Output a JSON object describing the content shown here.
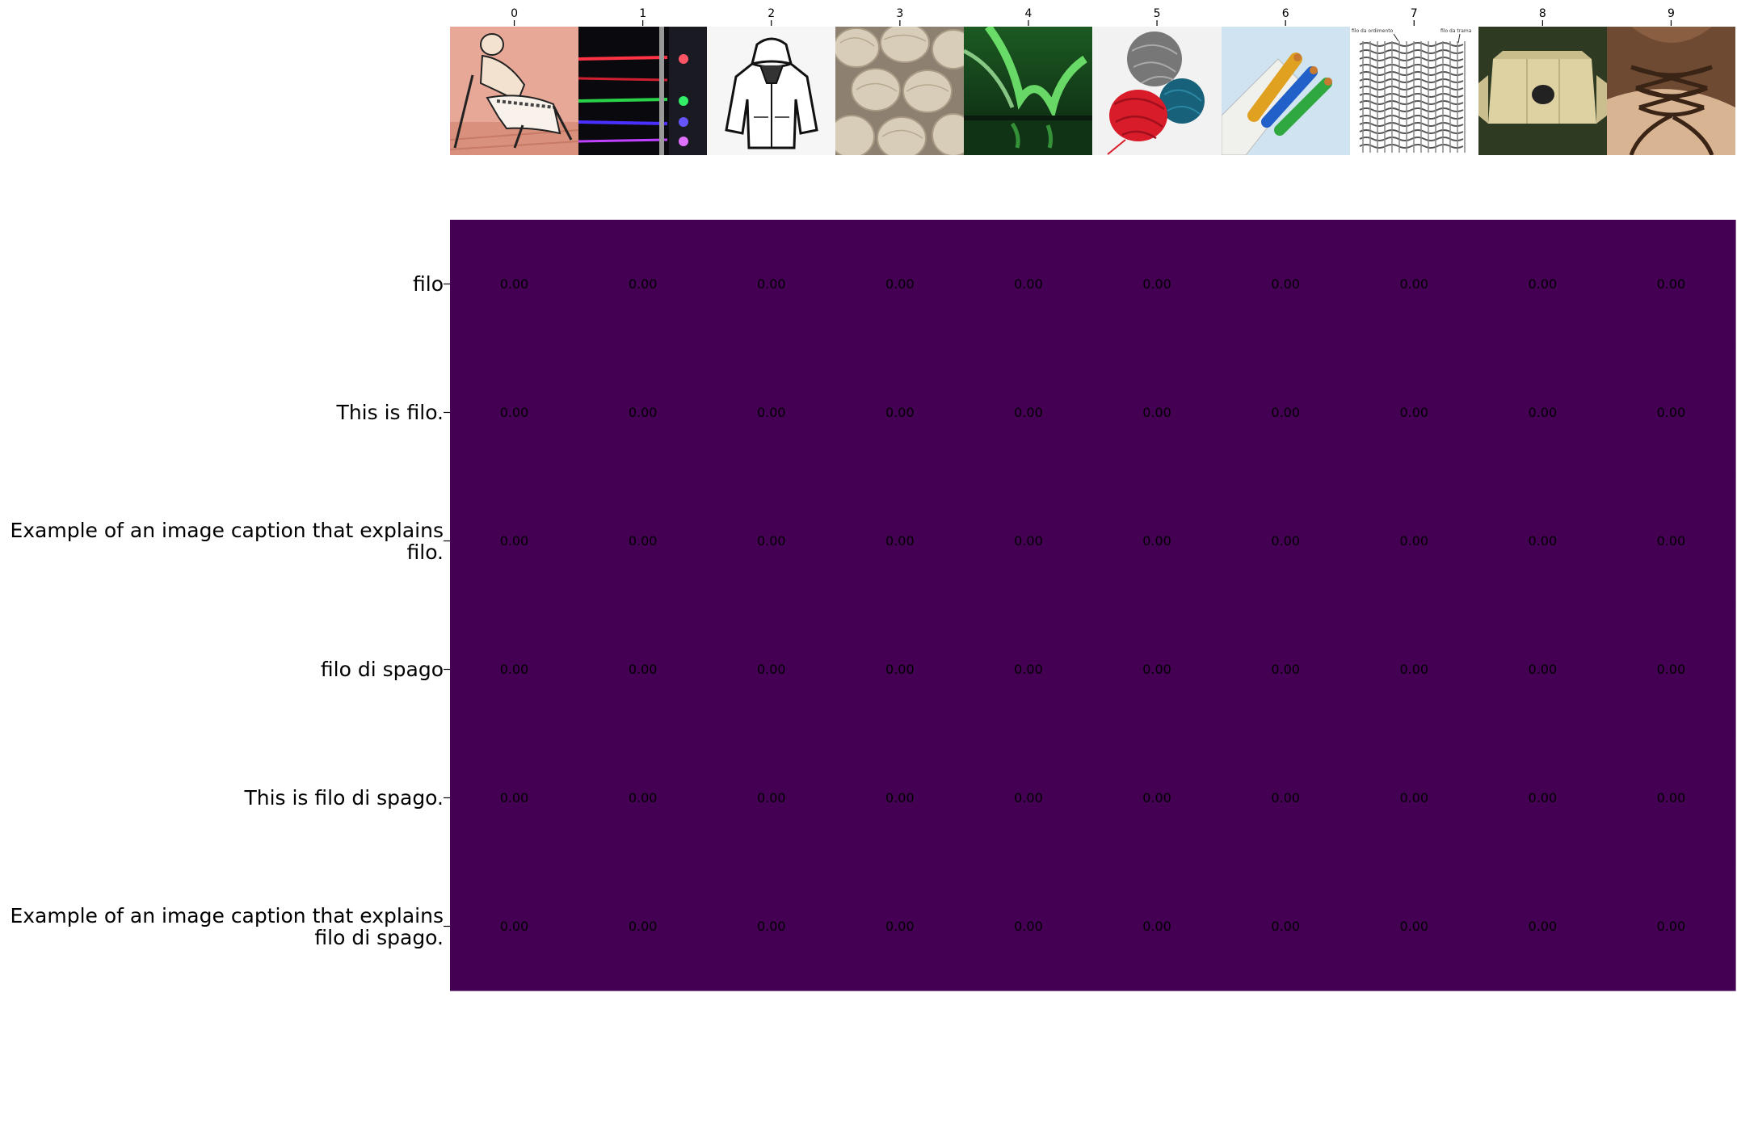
{
  "chart_data": {
    "type": "heatmap",
    "title": "",
    "xlabel": "",
    "ylabel": "",
    "x_tick_labels": [
      "0",
      "1",
      "2",
      "3",
      "4",
      "5",
      "6",
      "7",
      "8",
      "9"
    ],
    "y_tick_labels": [
      "filo",
      "This is filo.",
      "Example of an image caption that explains\nfilo.",
      "filo di spago",
      "This is filo di spago.",
      "Example of an image caption that explains\nfilo di spago."
    ],
    "values": [
      [
        0.0,
        0.0,
        0.0,
        0.0,
        0.0,
        0.0,
        0.0,
        0.0,
        0.0,
        0.0
      ],
      [
        0.0,
        0.0,
        0.0,
        0.0,
        0.0,
        0.0,
        0.0,
        0.0,
        0.0,
        0.0
      ],
      [
        0.0,
        0.0,
        0.0,
        0.0,
        0.0,
        0.0,
        0.0,
        0.0,
        0.0,
        0.0
      ],
      [
        0.0,
        0.0,
        0.0,
        0.0,
        0.0,
        0.0,
        0.0,
        0.0,
        0.0,
        0.0
      ],
      [
        0.0,
        0.0,
        0.0,
        0.0,
        0.0,
        0.0,
        0.0,
        0.0,
        0.0,
        0.0
      ],
      [
        0.0,
        0.0,
        0.0,
        0.0,
        0.0,
        0.0,
        0.0,
        0.0,
        0.0,
        0.0
      ]
    ],
    "value_format": "0.00",
    "colormap": "viridis",
    "cell_color": "#440154",
    "annotation_color": "#000000",
    "thumbnails": [
      "illustration-man-working",
      "colored-light-strings",
      "hoodie-sketch",
      "skeins-of-twine",
      "aurora-borealis",
      "yarn-balls",
      "electric-cables",
      "weave-diagram",
      "beige-object",
      "shoe-laces"
    ],
    "thumbnail_texts": [
      "filo da ordimento",
      "filo da trama"
    ]
  }
}
